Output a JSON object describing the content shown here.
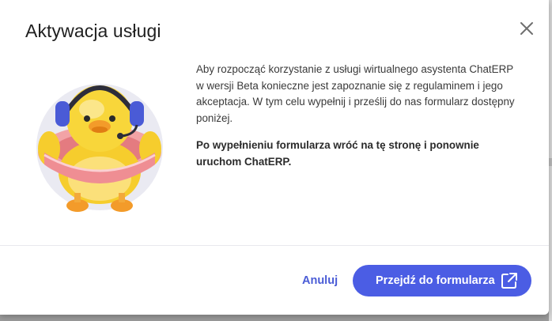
{
  "dialog": {
    "title": "Aktywacja usługi",
    "close_icon": "close-icon",
    "paragraphs": [
      "Aby rozpocząć korzystanie z usługi wirtualnego asystenta ChatERP w wersji Beta konieczne jest zapoznanie się z regulaminem i jego akceptacja. W tym celu wypełnij i prześlij do nas formularz dostępny poniżej.",
      "Po wypełnieniu formularza wróć na tę stronę i ponownie uruchom ChatERP."
    ],
    "illustration": "duck-with-headset-and-swim-ring",
    "buttons": {
      "cancel_label": "Anuluj",
      "primary_label": "Przejdź do formularza",
      "primary_icon": "external-link-icon"
    }
  },
  "colors": {
    "accent": "#4b5de4",
    "link": "#4a5cd6",
    "title": "#1f1f1f",
    "text": "#3a3a3a"
  }
}
